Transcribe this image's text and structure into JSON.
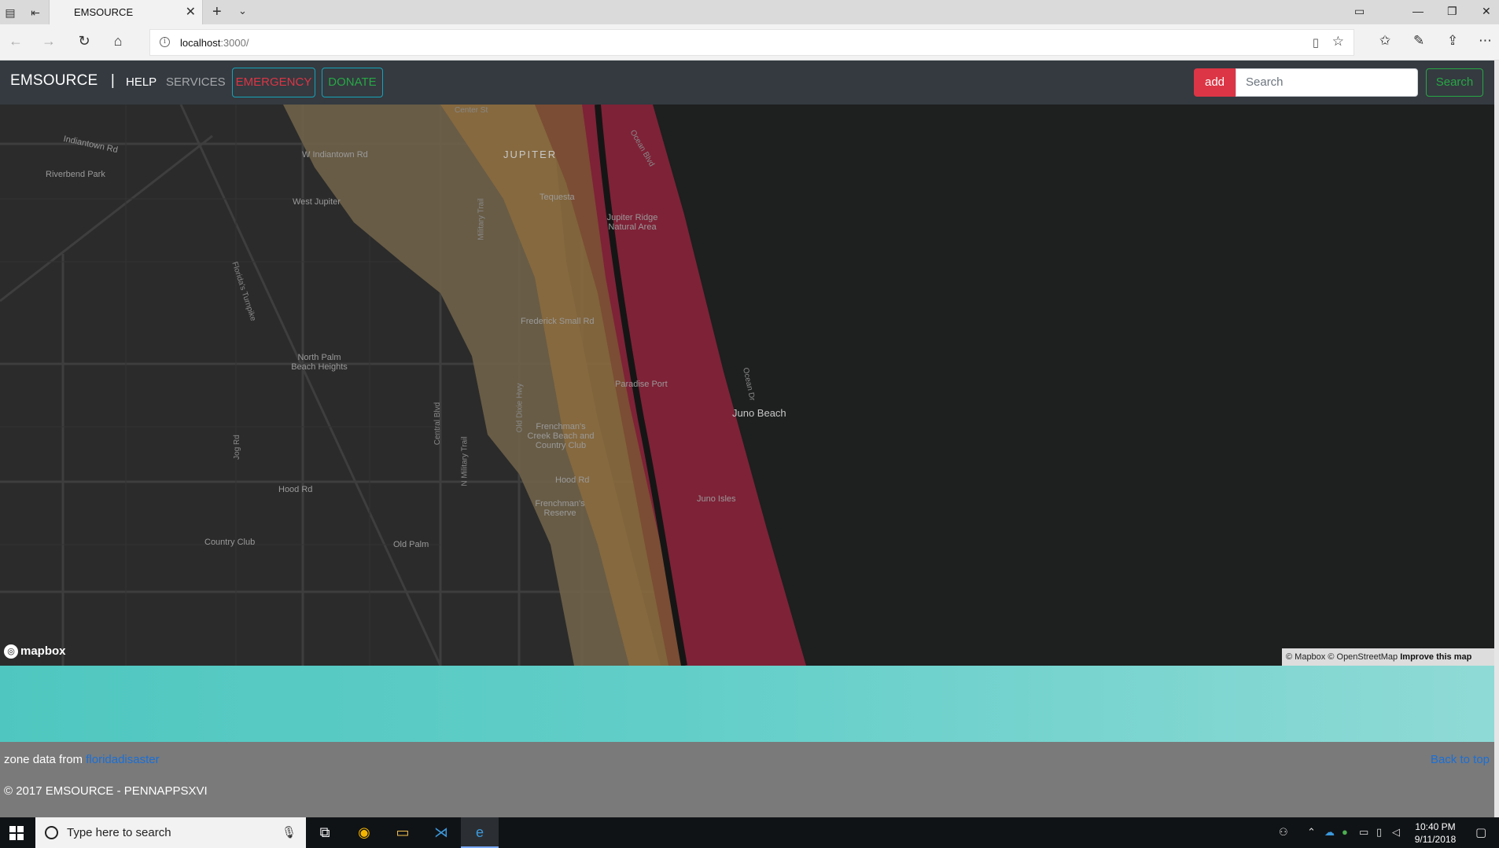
{
  "browser": {
    "tab_title": "EMSOURCE",
    "url_host": "localhost",
    "url_rest": ":3000/",
    "icons": [
      "tab-preview-icon",
      "tab-aside-icon",
      "close-icon",
      "new-tab-icon",
      "tab-dropdown-icon",
      "back-icon",
      "forward-icon",
      "refresh-icon",
      "home-icon",
      "info-icon",
      "reading-view-icon",
      "favorite-star-icon",
      "favorites-hub-icon",
      "pen-icon",
      "share-icon",
      "more-icon"
    ]
  },
  "navbar": {
    "brand": "EMSOURCE",
    "separator": "|",
    "help": "HELP",
    "services": "SERVICES",
    "emergency": "EMERGENCY",
    "donate": "DONATE",
    "add": "add",
    "search_placeholder": "Search",
    "search_button": "Search"
  },
  "map": {
    "labels": [
      "Center St",
      "Indiantown Rd",
      "W Indiantown Rd",
      "JUPITER",
      "Ocean Blvd",
      "Riverbend Park",
      "Tequesta",
      "West Jupiter",
      "Jupiter Ridge Natural Area",
      "Florida's Turnpike",
      "Military Trail",
      "Frederick Small Rd",
      "North Palm Beach Heights",
      "Paradise Port",
      "Ocean Dr",
      "Juno Beach",
      "Central Blvd",
      "Old Dixie Hwy",
      "Frenchman's Creek Beach and Country Club",
      "Jog Rd",
      "N Military Trail",
      "Hood Rd",
      "Frenchman's Reserve",
      "Juno Isles",
      "Country Club",
      "Old Palm"
    ],
    "logo": "mapbox",
    "attribution_text": "© Mapbox © OpenStreetMap",
    "attribution_link": "Improve this map"
  },
  "footer": {
    "zone_prefix": "zone data from",
    "zone_link": "floridadisaster",
    "back_to_top": "Back to top",
    "copyright": "© 2017 EMSOURCE - PENNAPPSXVI"
  },
  "taskbar": {
    "search_placeholder": "Type here to search",
    "time": "10:40 PM",
    "date": "9/11/2018"
  },
  "colors": {
    "navbar": "#343a40",
    "danger": "#dc3545",
    "success": "#28a745",
    "info": "#17a2b8",
    "map_bg": "#1e1f1f",
    "flood_zone_red": "#7e2237",
    "teal": "#4fc7c0",
    "footer": "#7a7a7a"
  }
}
